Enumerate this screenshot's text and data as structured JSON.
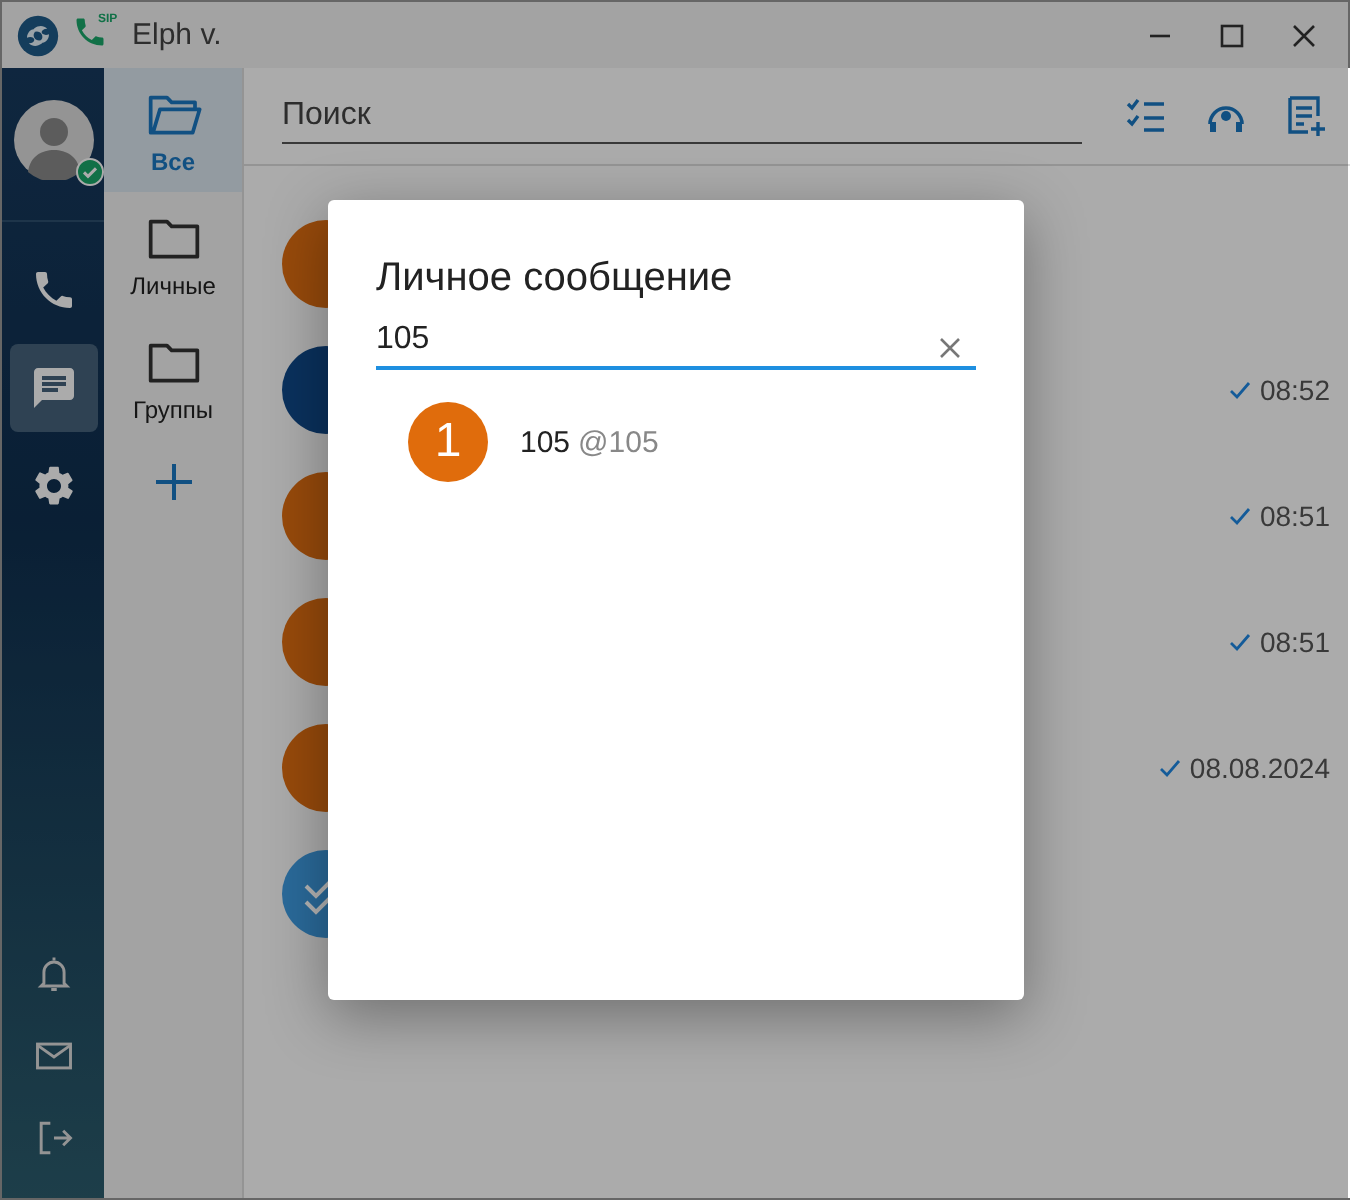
{
  "window": {
    "title": "Elph v.",
    "sip_label": "SIP"
  },
  "rail": {
    "profile": {
      "online": true
    },
    "nav": [
      {
        "kind": "phone",
        "selected": false
      },
      {
        "kind": "chat",
        "selected": true
      },
      {
        "kind": "settings",
        "selected": false
      }
    ],
    "bottom": [
      {
        "kind": "bell"
      },
      {
        "kind": "mail"
      },
      {
        "kind": "logout"
      }
    ]
  },
  "folders": [
    {
      "label": "Все",
      "selected": true,
      "kind": "open"
    },
    {
      "label": "Личные",
      "selected": false,
      "kind": "closed"
    },
    {
      "label": "Группы",
      "selected": false,
      "kind": "closed"
    }
  ],
  "search": {
    "placeholder": "Поиск"
  },
  "chats": [
    {
      "kind": "plain",
      "color": "#974a0b"
    },
    {
      "kind": "plain",
      "color": "#0a315d",
      "time": "08:52"
    },
    {
      "kind": "plain",
      "color": "#974a0b",
      "time": "08:51"
    },
    {
      "kind": "plain",
      "color": "#974a0b",
      "time": "08:51"
    },
    {
      "kind": "plain",
      "color": "#974a0b",
      "time": "08.08.2024"
    },
    {
      "kind": "check",
      "color": "#2a6a9a"
    }
  ],
  "dialog": {
    "title": "Личное сообщение",
    "query": "105",
    "results": [
      {
        "initial": "1",
        "color": "#e06c0c",
        "name": "105",
        "handle": "@105"
      }
    ]
  }
}
